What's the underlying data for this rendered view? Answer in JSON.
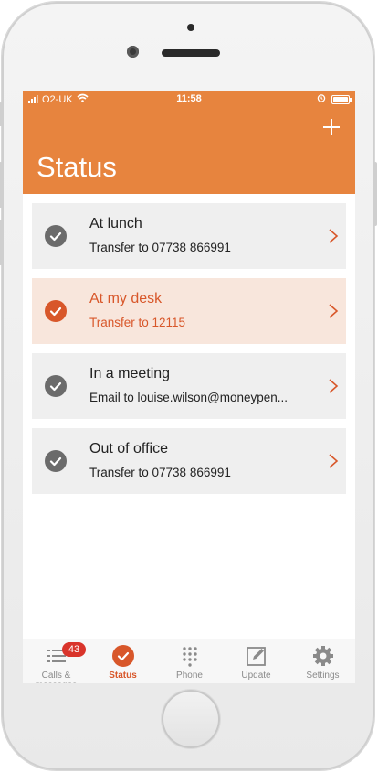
{
  "status_bar": {
    "carrier": "O2-UK",
    "time": "11:58"
  },
  "header": {
    "title": "Status",
    "add_icon": "plus-icon"
  },
  "statuses": [
    {
      "title": "At lunch",
      "subtitle": "Transfer to 07738 866991",
      "active": false
    },
    {
      "title": "At my desk",
      "subtitle": "Transfer to 12115",
      "active": true
    },
    {
      "title": "In a meeting",
      "subtitle": "Email to louise.wilson@moneypen...",
      "active": false
    },
    {
      "title": "Out of office",
      "subtitle": "Transfer to 07738 866991",
      "active": false
    }
  ],
  "tabs": [
    {
      "label": "Calls & messages",
      "icon": "list-icon",
      "badge": "43"
    },
    {
      "label": "Status",
      "icon": "check-circle-icon",
      "active": true
    },
    {
      "label": "Phone",
      "icon": "keypad-icon"
    },
    {
      "label": "Update",
      "icon": "edit-icon"
    },
    {
      "label": "Settings",
      "icon": "gear-icon"
    }
  ],
  "colors": {
    "brand": "#e7843e",
    "accent": "#d8572a",
    "active_bg": "#f8e6dc"
  }
}
